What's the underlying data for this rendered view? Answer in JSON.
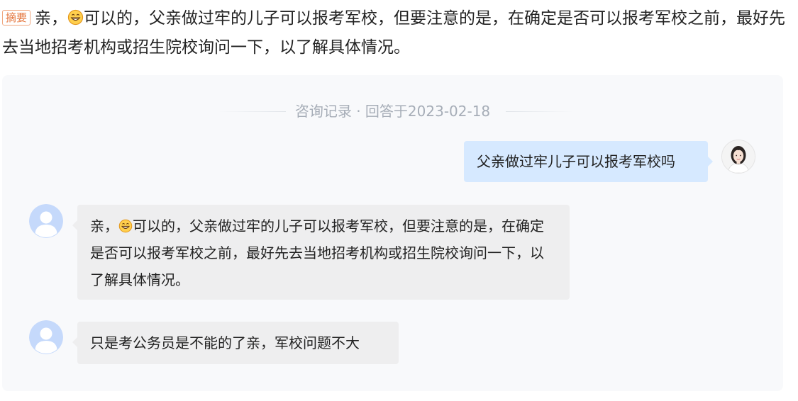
{
  "summary": {
    "tag": "摘要",
    "text_before_emoji": "亲，",
    "emoji": "grinning-face-emoji",
    "text_after_emoji": "可以的，父亲做过牢的儿子可以报考军校，但要注意的是，在确定是否可以报考军校之前，最好先去当地招考机构或招生院校询问一下，以了解具体情况。"
  },
  "consultation": {
    "title": "咨询记录 · 回答于2023-02-18",
    "messages": [
      {
        "sender": "user",
        "avatar": "user-avatar-photo",
        "text": "父亲做过牢儿子可以报考军校吗"
      },
      {
        "sender": "lawyer",
        "avatar": "default-person-avatar",
        "text_before_emoji": "亲，",
        "emoji": "grinning-face-emoji",
        "text_after_emoji": "可以的，父亲做过牢的儿子可以报考军校，但要注意的是，在确定是否可以报考军校之前，最好先去当地招考机构或招生院校询问一下，以了解具体情况。"
      },
      {
        "sender": "lawyer",
        "avatar": "default-person-avatar",
        "text": "只是考公务员是不能的了亲，军校问题不大"
      }
    ]
  },
  "colors": {
    "summary_tag": "#e4743b",
    "user_bubble": "#d6e9ff",
    "reply_bubble": "#eeeeef",
    "panel_background": "#f8f9fb",
    "header_text": "#a6adb7",
    "avatar_blue": "#c5d9fb"
  }
}
